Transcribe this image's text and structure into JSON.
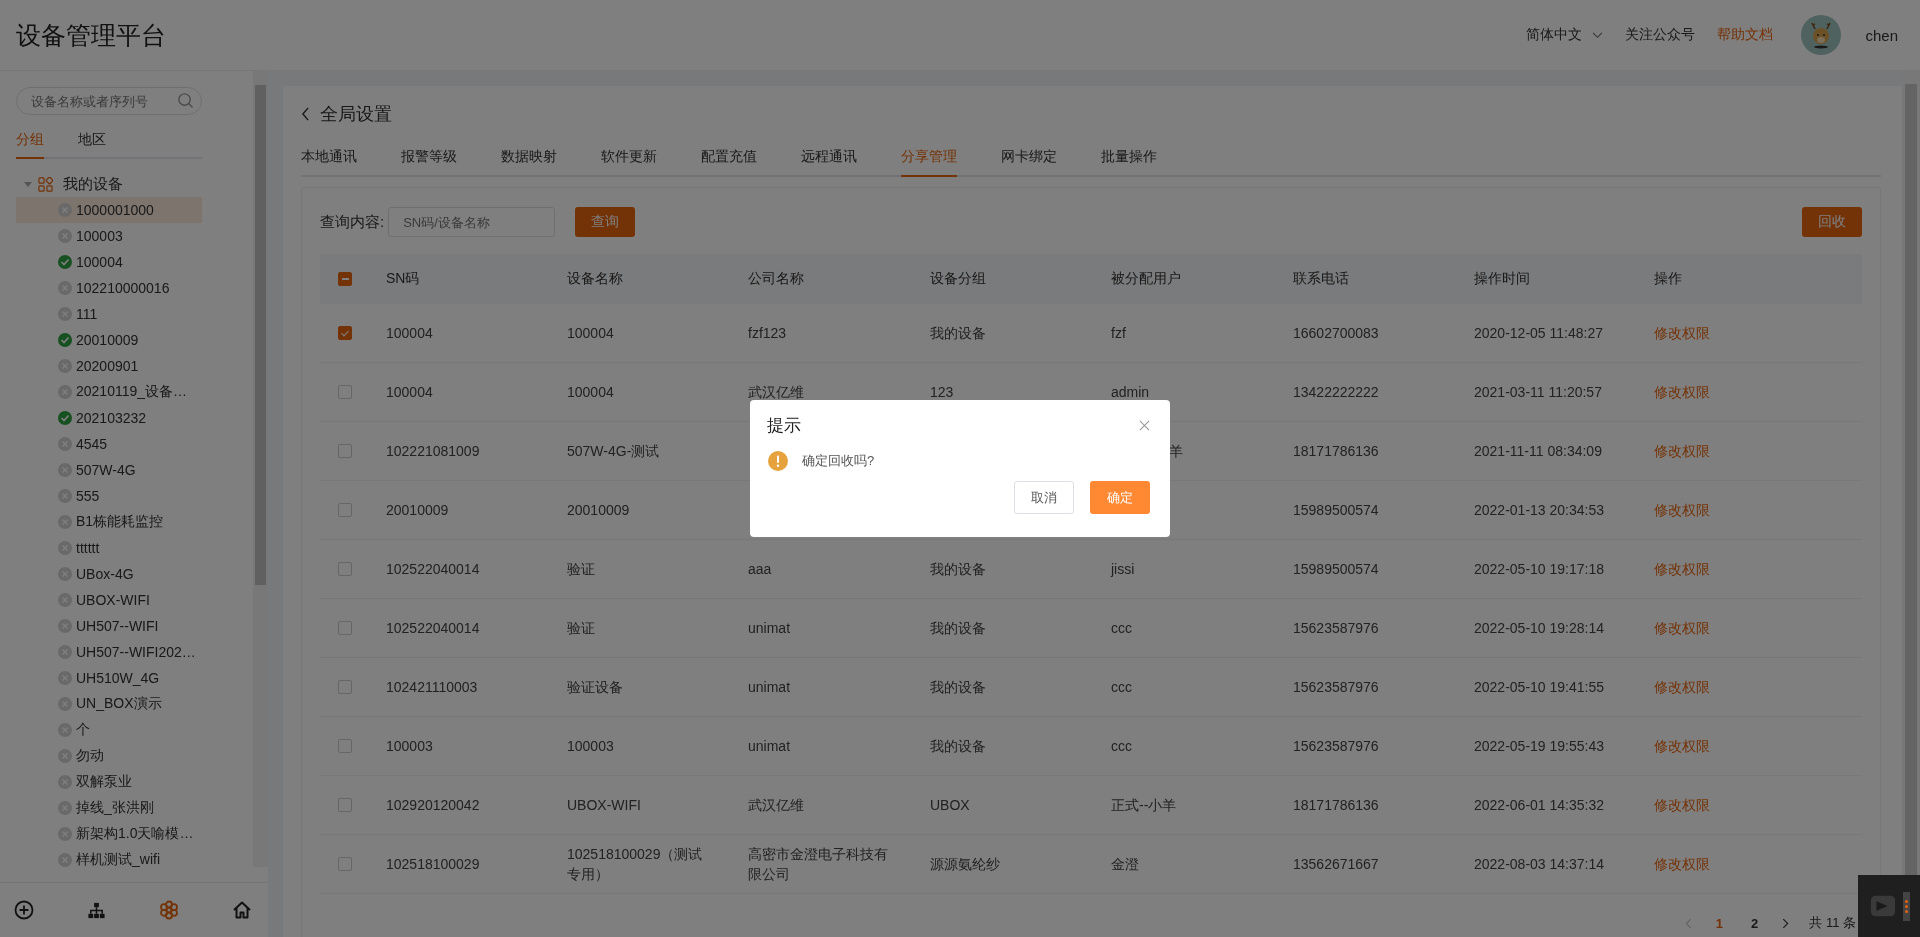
{
  "app": {
    "title": "设备管理平台"
  },
  "header": {
    "language": "简体中文",
    "follow": "关注公众号",
    "help": "帮助文档",
    "user": "chen"
  },
  "sidebar": {
    "search_placeholder": "设备名称或者序列号",
    "tabs": [
      {
        "label": "分组",
        "selected": true
      },
      {
        "label": "地区",
        "selected": false
      }
    ],
    "tree": [
      {
        "label": "我的设备",
        "expanded": true,
        "children": [
          {
            "label": "1000001000",
            "online": false,
            "selected": true
          },
          {
            "label": "100003",
            "online": false,
            "selected": false
          },
          {
            "label": "100004",
            "online": true,
            "selected": false
          },
          {
            "label": "102210000016",
            "online": false,
            "selected": false
          },
          {
            "label": "111",
            "online": false,
            "selected": false
          },
          {
            "label": "20010009",
            "online": true,
            "selected": false
          },
          {
            "label": "20200901",
            "online": false,
            "selected": false
          },
          {
            "label": "20210119_设备…",
            "online": false,
            "selected": false
          },
          {
            "label": "202103232",
            "online": true,
            "selected": false
          },
          {
            "label": "4545",
            "online": false,
            "selected": false
          },
          {
            "label": "507W-4G",
            "online": false,
            "selected": false
          },
          {
            "label": "555",
            "online": false,
            "selected": false
          },
          {
            "label": "B1栋能耗监控",
            "online": false,
            "selected": false
          },
          {
            "label": "tttttt",
            "online": false,
            "selected": false
          },
          {
            "label": "UBox-4G",
            "online": false,
            "selected": false
          },
          {
            "label": "UBOX-WIFI",
            "online": false,
            "selected": false
          },
          {
            "label": "UH507--WIFI",
            "online": false,
            "selected": false
          },
          {
            "label": "UH507--WIFI202…",
            "online": false,
            "selected": false
          },
          {
            "label": "UH510W_4G",
            "online": false,
            "selected": false
          },
          {
            "label": "UN_BOX演示",
            "online": false,
            "selected": false
          },
          {
            "label": "个",
            "online": false,
            "selected": false
          },
          {
            "label": "勿动",
            "online": false,
            "selected": false
          },
          {
            "label": "双解泵业",
            "online": false,
            "selected": false
          },
          {
            "label": "掉线_张洪刚",
            "online": false,
            "selected": false
          },
          {
            "label": "新架构1.0天喻模…",
            "online": false,
            "selected": false
          },
          {
            "label": "样机测试_wifi",
            "online": false,
            "selected": false
          }
        ]
      }
    ],
    "bottom_tabs": [
      {
        "kind": "add",
        "selected": false
      },
      {
        "kind": "org",
        "selected": false
      },
      {
        "kind": "device",
        "selected": true
      },
      {
        "kind": "home",
        "selected": false
      }
    ]
  },
  "page": {
    "back_title": "全局设置",
    "tabs": [
      {
        "label": "本地通讯",
        "selected": false
      },
      {
        "label": "报警等级",
        "selected": false
      },
      {
        "label": "数据映射",
        "selected": false
      },
      {
        "label": "软件更新",
        "selected": false
      },
      {
        "label": "配置充值",
        "selected": false
      },
      {
        "label": "远程通讯",
        "selected": false
      },
      {
        "label": "分享管理",
        "selected": true
      },
      {
        "label": "网卡绑定",
        "selected": false
      },
      {
        "label": "批量操作",
        "selected": false
      }
    ],
    "query_label": "查询内容:",
    "query_placeholder": "SN码/设备名称",
    "query_button": "查询",
    "recycle_button": "回收"
  },
  "table": {
    "select_all": {
      "checked": true,
      "indeterminate": true
    },
    "columns": [
      "SN码",
      "设备名称",
      "公司名称",
      "设备分组",
      "被分配用户",
      "联系电话",
      "操作时间",
      "操作"
    ],
    "rows": [
      {
        "checked": true,
        "cells": [
          "100004",
          "100004",
          "fzf123",
          "我的设备",
          "fzf",
          "16602700083",
          "2020-12-05 11:48:27"
        ],
        "action": "修改权限"
      },
      {
        "checked": false,
        "cells": [
          "100004",
          "100004",
          "武汉亿维",
          "123",
          "admin",
          "13422222222",
          "2021-03-11 11:20:57"
        ],
        "action": "修改权限"
      },
      {
        "checked": false,
        "cells": [
          "102221081009",
          "507W-4G-测试",
          null,
          null,
          {
            "text": "羊",
            "covered": true
          },
          "18171786136",
          "2021-11-11 08:34:09"
        ],
        "action": "修改权限"
      },
      {
        "checked": false,
        "cells": [
          "20010009",
          "20010009",
          null,
          null,
          null,
          "15989500574",
          "2022-01-13 20:34:53"
        ],
        "action": "修改权限"
      },
      {
        "checked": false,
        "cells": [
          "102522040014",
          "验证",
          "aaa",
          "我的设备",
          "jissi",
          "15989500574",
          "2022-05-10 19:17:18"
        ],
        "action": "修改权限"
      },
      {
        "checked": false,
        "cells": [
          "102522040014",
          "验证",
          "unimat",
          "我的设备",
          "ccc",
          "15623587976",
          "2022-05-10 19:28:14"
        ],
        "action": "修改权限"
      },
      {
        "checked": false,
        "cells": [
          "102421110003",
          "验证设备",
          "unimat",
          "我的设备",
          "ccc",
          "15623587976",
          "2022-05-10 19:41:55"
        ],
        "action": "修改权限"
      },
      {
        "checked": false,
        "cells": [
          "100003",
          "100003",
          "unimat",
          "我的设备",
          "ccc",
          "15623587976",
          "2022-05-19 19:55:43"
        ],
        "action": "修改权限"
      },
      {
        "checked": false,
        "cells": [
          "102920120042",
          "UBOX-WIFI",
          "武汉亿维",
          "UBOX",
          "正式--小羊",
          "18171786136",
          "2022-06-01 14:35:32"
        ],
        "action": "修改权限"
      },
      {
        "checked": false,
        "cells": [
          "102518100029",
          "102518100029（测试专用）",
          "高密市金澄电子科技有限公司",
          "源源氨纶纱",
          "金澄",
          "13562671667",
          "2022-08-03 14:37:14"
        ],
        "action": "修改权限"
      }
    ]
  },
  "pagination": {
    "prev_disabled": true,
    "pages": [
      {
        "label": "1",
        "selected": true
      },
      {
        "label": "2",
        "selected": false
      }
    ],
    "total": "共 11 条"
  },
  "dialog": {
    "title": "提示",
    "message": "确定回收吗?",
    "cancel": "取消",
    "confirm": "确定"
  }
}
